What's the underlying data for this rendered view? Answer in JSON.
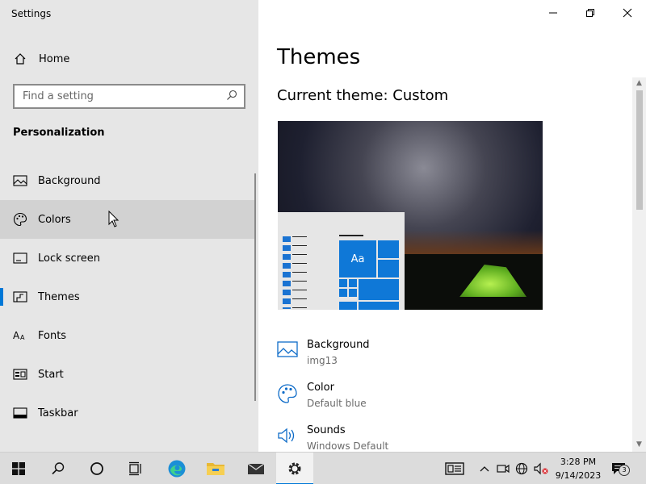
{
  "window": {
    "title": "Settings"
  },
  "sidebar": {
    "home_label": "Home",
    "search_placeholder": "Find a setting",
    "section_title": "Personalization",
    "items": [
      {
        "label": "Background",
        "icon": "image-icon"
      },
      {
        "label": "Colors",
        "icon": "palette-icon"
      },
      {
        "label": "Lock screen",
        "icon": "lock-screen-icon"
      },
      {
        "label": "Themes",
        "icon": "themes-icon"
      },
      {
        "label": "Fonts",
        "icon": "fonts-icon"
      },
      {
        "label": "Start",
        "icon": "start-icon"
      },
      {
        "label": "Taskbar",
        "icon": "taskbar-icon"
      }
    ],
    "selected": "Themes",
    "hovered": "Colors"
  },
  "main": {
    "title": "Themes",
    "current_theme": "Current theme: Custom",
    "preview_tile_label": "Aa",
    "settings": [
      {
        "name": "Background",
        "value": "img13",
        "icon": "image-icon"
      },
      {
        "name": "Color",
        "value": "Default blue",
        "icon": "palette-icon"
      },
      {
        "name": "Sounds",
        "value": "Windows Default",
        "icon": "speaker-icon"
      }
    ]
  },
  "taskbar": {
    "time": "3:28 PM",
    "date": "9/14/2023",
    "notification_count": "3"
  },
  "colors": {
    "accent": "#0078d7",
    "sidebar_bg": "#e6e6e6",
    "taskbar_bg": "#dcdcdc"
  }
}
